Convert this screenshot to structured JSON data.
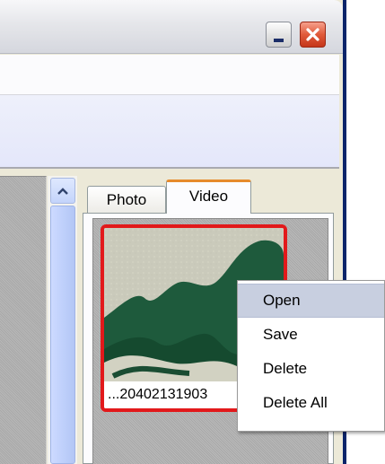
{
  "window": {
    "controls": {
      "minimize_icon": "minimize-icon",
      "close_icon": "close-icon"
    }
  },
  "tabs": [
    {
      "label": "Photo",
      "active": false
    },
    {
      "label": "Video",
      "active": true
    }
  ],
  "thumbnail": {
    "filename": "...20402131903",
    "selected": true
  },
  "context_menu": {
    "items": [
      {
        "label": "Open",
        "highlighted": true
      },
      {
        "label": "Save",
        "highlighted": false
      },
      {
        "label": "Delete",
        "highlighted": false
      },
      {
        "label": "Delete All",
        "highlighted": false
      }
    ]
  },
  "colors": {
    "selection_border": "#e2191b",
    "active_tab_accent": "#e68b2c",
    "scrollbar": "#c4d4fb",
    "menu_highlight": "#c8cfe0"
  }
}
